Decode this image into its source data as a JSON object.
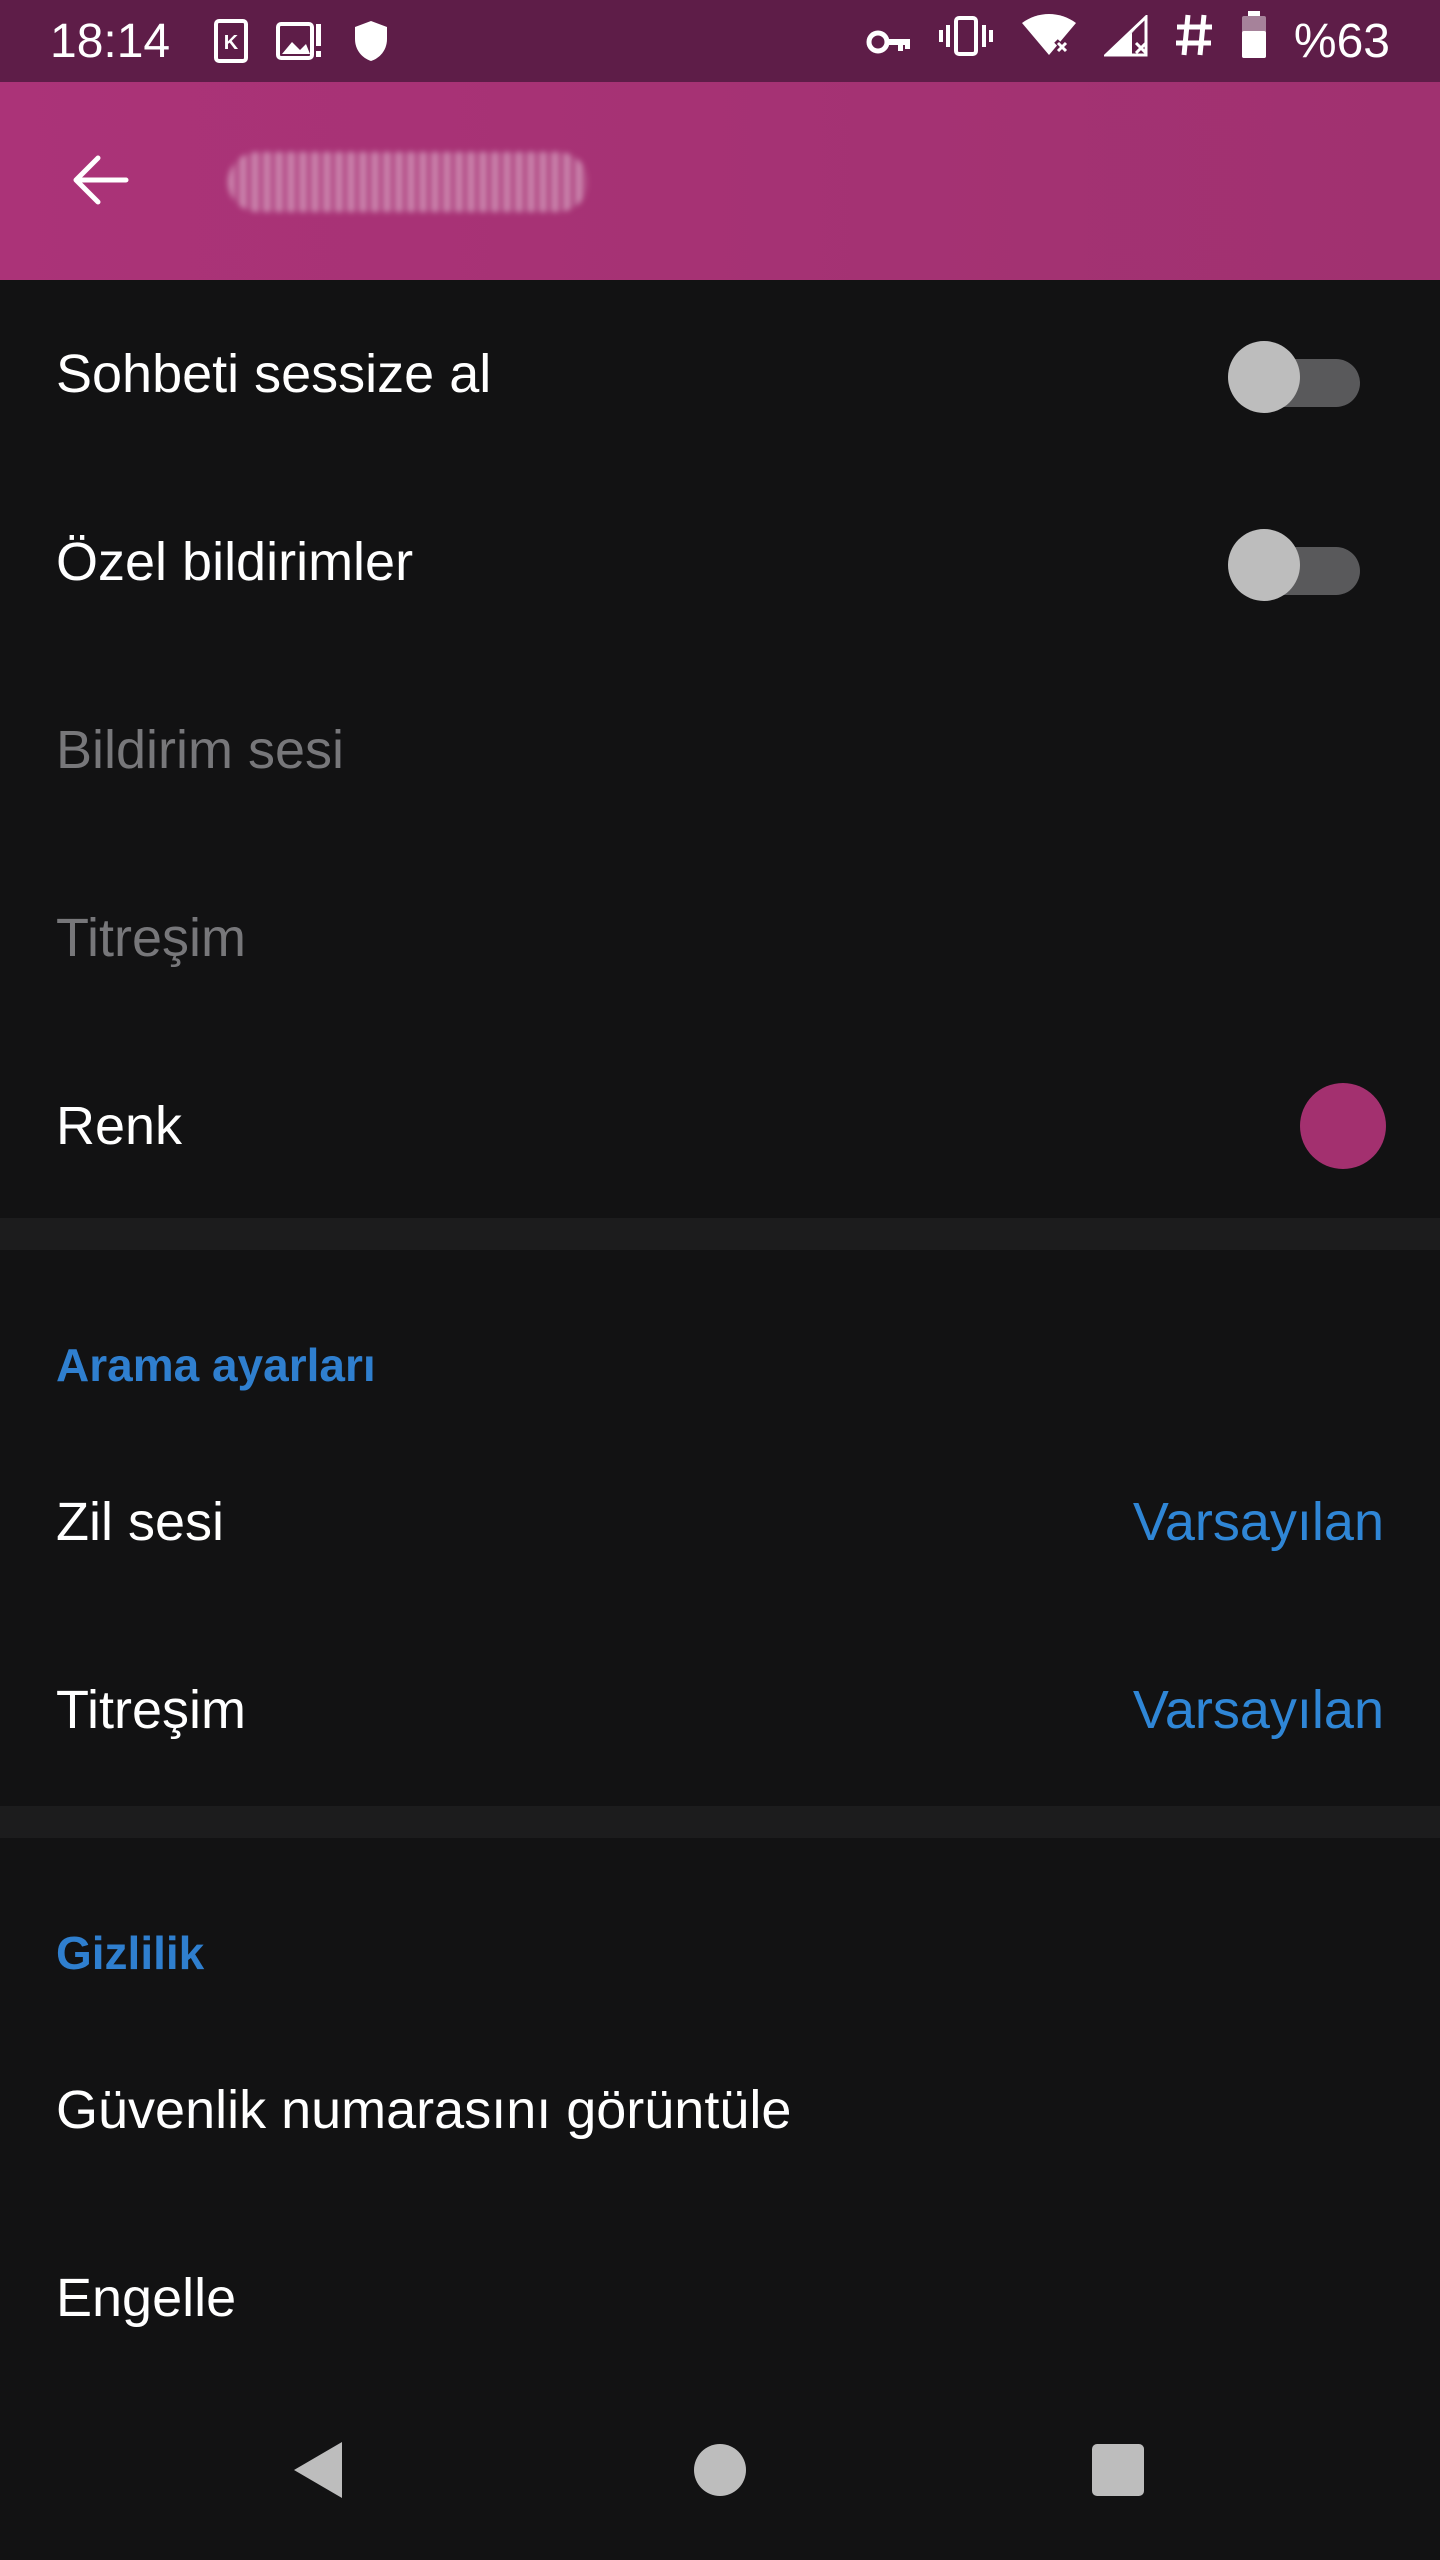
{
  "status_bar": {
    "time": "18:14",
    "battery_text": "%63",
    "icons_left": [
      "k-badge-icon",
      "image-alert-icon",
      "shield-icon"
    ],
    "icons_right": [
      "key-icon",
      "vibrate-icon",
      "wifi-off-icon",
      "signal-off-icon",
      "hash-icon",
      "battery-icon"
    ]
  },
  "app_bar": {
    "back_icon": "arrow-left-icon",
    "title_obscured": true
  },
  "notifications": {
    "mute_label": "Sohbeti sessize al",
    "mute_on": false,
    "custom_label": "Özel bildirimler",
    "custom_on": false,
    "sound_label": "Bildirim sesi",
    "vibration_label": "Titreşim",
    "color_label": "Renk",
    "color_value": "#a3306f"
  },
  "call_settings": {
    "header": "Arama ayarları",
    "ringtone_label": "Zil sesi",
    "ringtone_value": "Varsayılan",
    "vibration_label": "Titreşim",
    "vibration_value": "Varsayılan"
  },
  "privacy": {
    "header": "Gizlilik",
    "safety_number_label": "Güvenlik numarasını görüntüle",
    "block_label": "Engelle"
  },
  "colors": {
    "status_bar": "#5e1d48",
    "app_bar": "#ab3378",
    "background": "#121213",
    "accent_blue": "#2f86d6"
  },
  "nav_bar": {
    "icons": [
      "back-triangle-icon",
      "home-circle-icon",
      "recents-square-icon"
    ]
  }
}
